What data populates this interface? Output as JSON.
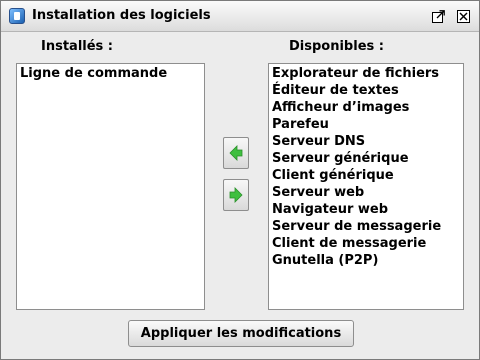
{
  "window": {
    "title": "Installation des logiciels"
  },
  "installed": {
    "label": "Installés :",
    "items": [
      "Ligne de commande"
    ]
  },
  "available": {
    "label": "Disponibles :",
    "items": [
      "Explorateur de fichiers",
      "Éditeur de textes",
      "Afficheur d’images",
      "Parefeu",
      "Serveur DNS",
      "Serveur générique",
      "Client générique",
      "Serveur web",
      "Navigateur web",
      "Serveur de messagerie",
      "Client de messagerie",
      "Gnutella (P2P)"
    ]
  },
  "actions": {
    "apply_label": "Appliquer les modifications"
  },
  "icons": {
    "app": "application-icon",
    "maximize": "maximize-icon",
    "close": "close-icon",
    "move_left": "arrow-left-icon",
    "move_right": "arrow-right-icon"
  },
  "colors": {
    "arrow_green": "#3fbf3f",
    "background": "#ececec"
  }
}
